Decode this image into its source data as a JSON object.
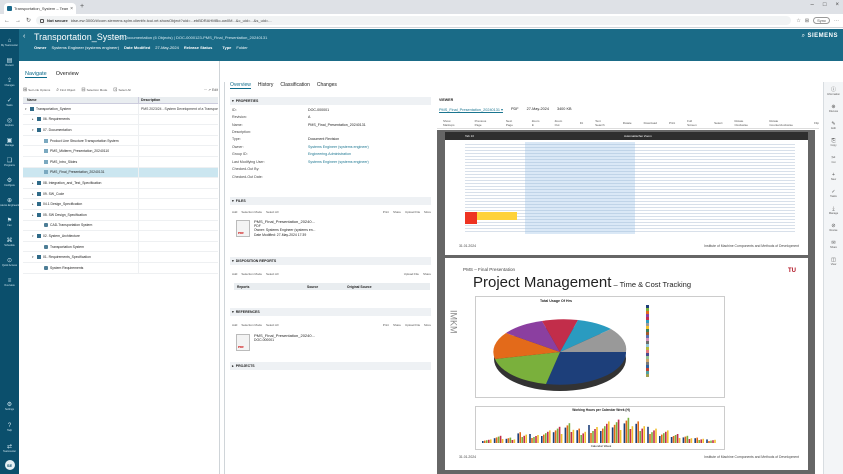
{
  "browser": {
    "tab_title": "Transportation_System – Teamc",
    "address_label": "Not secure",
    "url": "idse-ew:3000/#/com.siemens.splm.clientfx.tcui.xrt.showObject?uid=...ebBDRAHMBo-ow0M...&c_uid=...&s_uid=...",
    "sync_label": "Sync"
  },
  "rail": {
    "items": [
      {
        "glyph": "⌂",
        "label": "My Teamcenter"
      },
      {
        "glyph": "▤",
        "label": "Recent"
      },
      {
        "glyph": "⇪",
        "label": "Changes"
      },
      {
        "glyph": "✓",
        "label": "Tasks"
      },
      {
        "glyph": "◎",
        "label": "Explore"
      },
      {
        "glyph": "▣",
        "label": "Manage"
      },
      {
        "glyph": "❑",
        "label": "Programs"
      },
      {
        "glyph": "⚙",
        "label": "Configure"
      },
      {
        "glyph": "⊕",
        "label": "Systems Engineering"
      },
      {
        "glyph": "⚑",
        "label": "Fav"
      },
      {
        "glyph": "⌘",
        "label": "Schedule"
      },
      {
        "glyph": "⊙",
        "label": "Quick Access"
      },
      {
        "glyph": "≡",
        "label": "Overview"
      }
    ],
    "bottom": [
      {
        "glyph": "⚙",
        "label": "Settings"
      },
      {
        "glyph": "?",
        "label": "Help"
      },
      {
        "glyph": "⇄",
        "label": "Teamcenter"
      }
    ],
    "avatar_initials": "SE"
  },
  "header": {
    "title": "Transportation_System",
    "context": "> 07. Documentation (6 Objects) | DOC-0000123-PMS_Final_Presentation_20240131",
    "meta": [
      {
        "key": "Owner",
        "value": "Systems Engineer (systems engineer)"
      },
      {
        "key": "Date Modified",
        "value": "27-May-2024"
      },
      {
        "key": "Release Status",
        "value": ""
      },
      {
        "key": "Type",
        "value": "Folder"
      }
    ],
    "search_glyph": "⌕",
    "logo": "SIEMENS"
  },
  "navigate": {
    "tabs": [
      "Navigate",
      "Overview"
    ],
    "active_tab": "Navigate",
    "toolbar": [
      {
        "glyph": "⊞",
        "label": "Set Link Options"
      },
      {
        "glyph": "⌕",
        "label": "Find Object"
      },
      {
        "glyph": "⊟",
        "label": "Selection Mode"
      },
      {
        "glyph": "⊡",
        "label": "Select All"
      }
    ],
    "toolbar_right": "⋯ ↗ Edit",
    "columns": [
      "Name",
      "Description"
    ],
    "rows": [
      {
        "indent": 0,
        "exp": "▾",
        "icon": "f",
        "name": "Transportation_System",
        "desc": "PMS 2023/24 - System Development of a Transport..."
      },
      {
        "indent": 1,
        "exp": "▸",
        "icon": "f",
        "name": "06. Requirements",
        "desc": ""
      },
      {
        "indent": 1,
        "exp": "▾",
        "icon": "f",
        "name": "07. Documentation",
        "desc": ""
      },
      {
        "indent": 2,
        "exp": "",
        "icon": "d",
        "name": "Product Line Structure Transportation System",
        "desc": ""
      },
      {
        "indent": 2,
        "exp": "",
        "icon": "d",
        "name": "PMS_Midterm_Presentation_20240110",
        "desc": ""
      },
      {
        "indent": 2,
        "exp": "",
        "icon": "d",
        "name": "PMS_Intro_Slides",
        "desc": ""
      },
      {
        "indent": 2,
        "exp": "",
        "icon": "d",
        "name": "PMS_Final_Presentation_20240131",
        "desc": "",
        "selected": true
      },
      {
        "indent": 1,
        "exp": "▸",
        "icon": "f",
        "name": "08. Integration_and_Test_Specification",
        "desc": ""
      },
      {
        "indent": 1,
        "exp": "▸",
        "icon": "f",
        "name": "09. SW_Code",
        "desc": ""
      },
      {
        "indent": 1,
        "exp": "▸",
        "icon": "f",
        "name": "04.1 Design_Specification",
        "desc": ""
      },
      {
        "indent": 1,
        "exp": "▸",
        "icon": "f",
        "name": "05. SW Design_Specification",
        "desc": ""
      },
      {
        "indent": 2,
        "exp": "",
        "icon": "e",
        "name": "CAD-Transportation System",
        "desc": ""
      },
      {
        "indent": 1,
        "exp": "▾",
        "icon": "f",
        "name": "02. System_Architecture",
        "desc": ""
      },
      {
        "indent": 2,
        "exp": "",
        "icon": "e",
        "name": "Transportation System",
        "desc": ""
      },
      {
        "indent": 1,
        "exp": "▾",
        "icon": "f",
        "name": "01. Requirements_Specification",
        "desc": ""
      },
      {
        "indent": 2,
        "exp": "",
        "icon": "e",
        "name": "System Requirements",
        "desc": ""
      }
    ]
  },
  "details": {
    "tabs": [
      "Overview",
      "History",
      "Classification",
      "Changes"
    ],
    "active_tab": "Overview",
    "sections": {
      "properties": "PROPERTIES",
      "files": "FILES",
      "disposition": "DISPOSITION REPORTS",
      "references": "REFERENCES",
      "projects": "PROJECTS"
    },
    "properties": [
      {
        "k": "ID:",
        "v": "DOC-000001",
        "link": false
      },
      {
        "k": "Revision:",
        "v": "A",
        "link": false
      },
      {
        "k": "Name:",
        "v": "PMS_Final_Presentation_20240131",
        "link": false
      },
      {
        "k": "Description:",
        "v": "",
        "link": false
      },
      {
        "k": "Type:",
        "v": "Document Revision",
        "link": false
      },
      {
        "k": "Owner:",
        "v": "Systems Engineer (systems engineer)",
        "link": true
      },
      {
        "k": "Group ID:",
        "v": "Engineering.Administration",
        "link": true
      },
      {
        "k": "Last Modifying User:",
        "v": "Systems Engineer (systems engineer)",
        "link": true
      },
      {
        "k": "Checked-Out By:",
        "v": "",
        "link": false
      },
      {
        "k": "Checked-Out Date:",
        "v": "",
        "link": false
      }
    ],
    "files_toolbar": [
      "Add",
      "Selection Mode",
      "Select All"
    ],
    "files_toolbar_right": [
      "Print",
      "Share",
      "Upload File",
      "More"
    ],
    "file": {
      "name": "PMS_Final_Presentation_20240...",
      "type": "PDF",
      "owner": "Owner: Systems Engineer (systems en...",
      "date": "Date Modified: 27-May-2024 17:39"
    },
    "disposition_toolbar": [
      "Add",
      "Selection Mode",
      "Select All"
    ],
    "disposition_right": [
      "Upload File",
      "Share"
    ],
    "report_columns": [
      "Reports",
      "Source",
      "Original Source"
    ],
    "references_toolbar": [
      "Add",
      "Selection Mode",
      "Select All"
    ],
    "references_right": [
      "Print",
      "Share",
      "Upload File",
      "More"
    ],
    "reference": {
      "name": "PMS_Final_Presentation_20240...",
      "id": "DOC-000001"
    }
  },
  "viewer": {
    "label": "VIEWER",
    "file_name": "PMS_Final_Presentation_20240131 ▾",
    "file_type": "PDF",
    "file_date": "27-May-2024",
    "file_size": "3400 KB",
    "tools": [
      "Show Markups",
      "Previous Page",
      "Next Page",
      "Zoom In",
      "Zoom Out",
      "Fit",
      "Text Search",
      "Rotate",
      "Download",
      "Print",
      "Full Screen",
      "Select",
      "Rotate Clockwise",
      "Rotate Counterclockwise",
      "Flip"
    ],
    "slide1": {
      "bar_left": "Tab 10",
      "bar_title": "Automatischer Zoom",
      "date": "31.01.2024",
      "institute": "Institute of Machine Components and Methods of Development"
    },
    "slide2": {
      "header": "PMS – Final Presentation",
      "title": "Project Management",
      "subtitle": " – Time & Cost Tracking",
      "logo": "TU",
      "side": "IMKM",
      "pie_title": "Total Usage Of Hrs",
      "bar_title": "Working Hours per Calendar Week (H)",
      "bar_xlabel": "Calendar Week",
      "date": "31.01.2024",
      "institute": "Institute of Machine Components and Methods of Development"
    }
  },
  "right_rail": [
    {
      "glyph": "ⓘ",
      "label": "Information"
    },
    {
      "glyph": "⊕",
      "label": "Discuss"
    },
    {
      "glyph": "✎",
      "label": "Edit"
    },
    {
      "glyph": "⎘",
      "label": "Copy"
    },
    {
      "glyph": "✂",
      "label": "Cut"
    },
    {
      "glyph": "+",
      "label": "New"
    },
    {
      "glyph": "✓",
      "label": "Tasks"
    },
    {
      "glyph": "⤓",
      "label": "Manage"
    },
    {
      "glyph": "⊘",
      "label": "Revise"
    },
    {
      "glyph": "✉",
      "label": "Share"
    },
    {
      "glyph": "◫",
      "label": "View"
    }
  ],
  "colors": {
    "rail": "#0b4f6c",
    "header": "#1a6b87",
    "accent": "#0b6a8a",
    "selected_row": "#cbe6f0"
  }
}
